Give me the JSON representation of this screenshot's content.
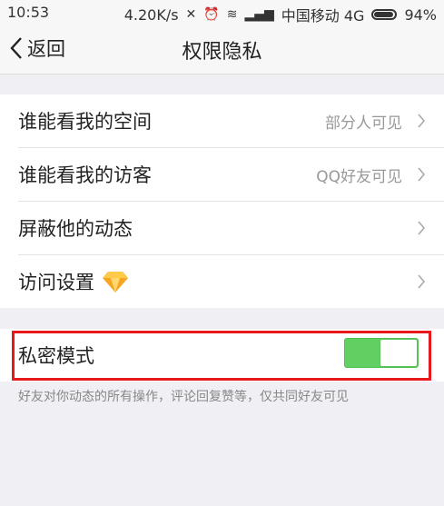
{
  "status_bar": {
    "time": "10:53",
    "speed": "4.20K/s",
    "carrier": "中国移动 4G",
    "battery": "94%"
  },
  "nav": {
    "back_label": "返回",
    "title": "权限隐私"
  },
  "settings": {
    "items": [
      {
        "label": "谁能看我的空间",
        "value": "部分人可见"
      },
      {
        "label": "谁能看我的访客",
        "value": "QQ好友可见"
      },
      {
        "label": "屏蔽他的动态",
        "value": ""
      },
      {
        "label": "访问设置",
        "value": ""
      }
    ]
  },
  "privacy": {
    "label": "私密模式",
    "toggle_on": true,
    "note": "好友对你动态的所有操作，评论回复赞等，仅共同好友可见"
  },
  "colors": {
    "toggle_on": "#62cf62",
    "highlight": "#e8191d",
    "diamond": "#f5a623"
  }
}
